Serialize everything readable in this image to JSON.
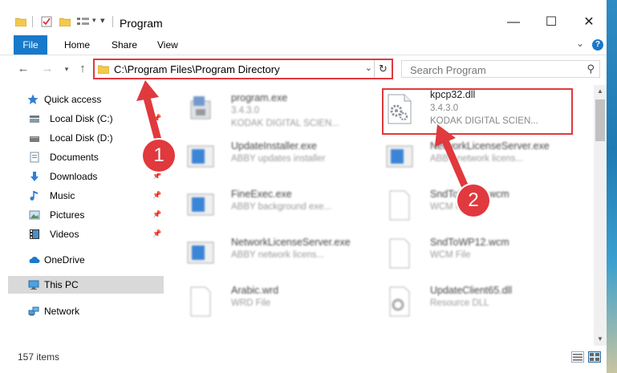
{
  "window": {
    "title": "Program"
  },
  "ribbon": {
    "tabs": [
      "File",
      "Home",
      "Share",
      "View"
    ]
  },
  "nav": {
    "address": "C:\\Program Files\\Program Directory",
    "search_placeholder": "Search Program"
  },
  "sidebar": {
    "items": [
      {
        "label": "Quick access",
        "icon": "star-icon"
      },
      {
        "label": "Local Disk (C:)",
        "icon": "drive-icon"
      },
      {
        "label": "Local Disk (D:)",
        "icon": "drive-icon"
      },
      {
        "label": "Documents",
        "icon": "documents-icon"
      },
      {
        "label": "Downloads",
        "icon": "download-icon"
      },
      {
        "label": "Music",
        "icon": "music-icon"
      },
      {
        "label": "Pictures",
        "icon": "pictures-icon"
      },
      {
        "label": "Videos",
        "icon": "videos-icon"
      },
      {
        "label": "OneDrive",
        "icon": "cloud-icon"
      },
      {
        "label": "This PC",
        "icon": "computer-icon"
      },
      {
        "label": "Network",
        "icon": "network-icon"
      }
    ]
  },
  "files": [
    {
      "name": "program.exe",
      "line2": "3.4.3.0",
      "line3": "KODAK DIGITAL SCIEN..."
    },
    {
      "name": "kpcp32.dll",
      "line2": "3.4.3.0",
      "line3": "KODAK DIGITAL SCIEN..."
    },
    {
      "name": "UpdateInstaller.exe",
      "line2": "ABBY updates installer",
      "line3": ""
    },
    {
      "name": "NetworkLicenseServer.exe",
      "line2": "ABBY network licens...",
      "line3": ""
    },
    {
      "name": "FineExec.exe",
      "line2": "ABBY background exe...",
      "line3": ""
    },
    {
      "name": "SndToWP12.wcm",
      "line2": "WCM File",
      "line3": ""
    },
    {
      "name": "NetworkLicenseServer.exe",
      "line2": "ABBY network licens...",
      "line3": ""
    },
    {
      "name": "SndToWP12.wcm",
      "line2": "WCM File",
      "line3": ""
    },
    {
      "name": "Arabic.wrd",
      "line2": "WRD File",
      "line3": ""
    },
    {
      "name": "UpdateClient65.dll",
      "line2": "Resource DLL",
      "line3": ""
    }
  ],
  "callouts": {
    "one": "1",
    "two": "2"
  },
  "status": {
    "items_count": "157 items"
  },
  "colors": {
    "accent": "#1979ca",
    "highlight": "#e0393e",
    "selected": "#d9d9d9"
  }
}
